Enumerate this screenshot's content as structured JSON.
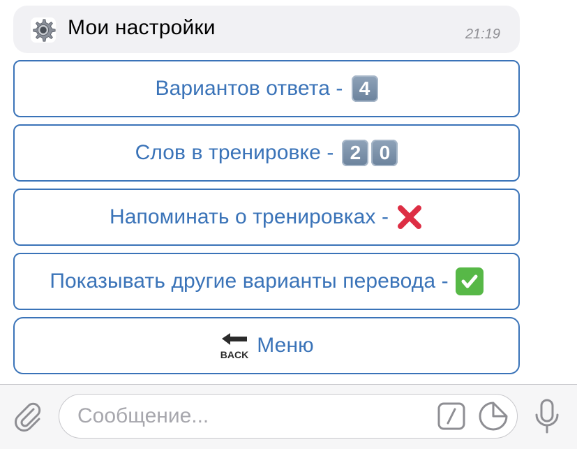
{
  "message": {
    "icon": "gear-icon",
    "title": "Мои настройки",
    "time": "21:19"
  },
  "keyboard": {
    "buttons": [
      {
        "label": "Вариантов ответа -",
        "emoji": [
          "4"
        ],
        "emoji_type": "keycap"
      },
      {
        "label": "Слов в тренировке -",
        "emoji": [
          "2",
          "0"
        ],
        "emoji_type": "keycap"
      },
      {
        "label": "Напоминать о тренировках -",
        "emoji_type": "cross-mark"
      },
      {
        "label": "Показывать другие варианты перевода -",
        "emoji_type": "check-mark"
      },
      {
        "label": "Меню",
        "icon": "back-arrow-icon",
        "icon_text": "BACK"
      }
    ]
  },
  "input_bar": {
    "placeholder": "Сообщение...",
    "icons": [
      "paperclip-icon",
      "bot-commands-icon",
      "sticker-icon",
      "microphone-icon"
    ]
  },
  "colors": {
    "accent": "#3a73b8",
    "bubble": "#f1f1f4",
    "time": "#8e8e93",
    "cross": "#dd2e44",
    "check": "#57b847"
  }
}
